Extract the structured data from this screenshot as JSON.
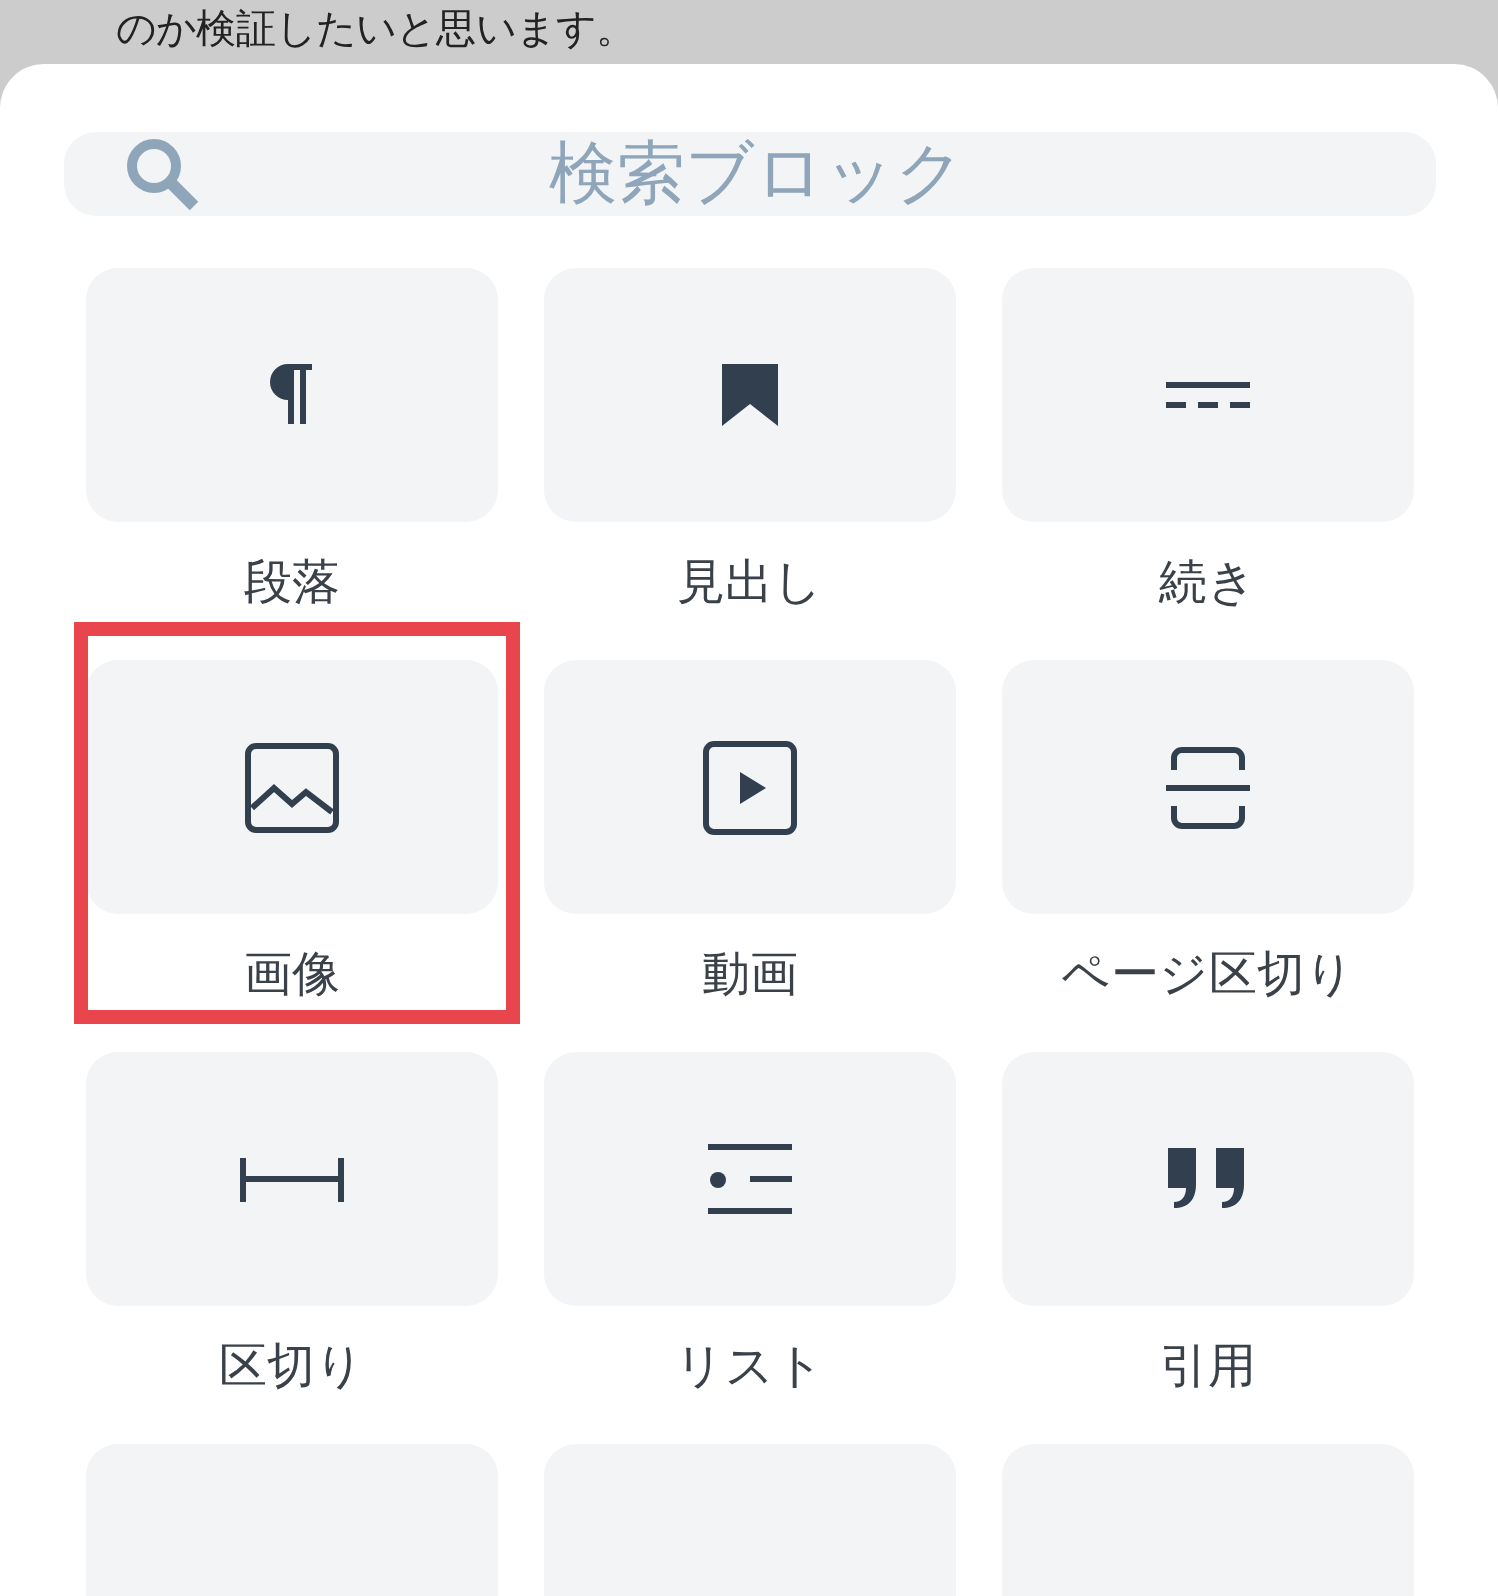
{
  "background_text": "のか検証したいと思います。",
  "search": {
    "placeholder": "検索ブロック"
  },
  "blocks": [
    {
      "kind": "paragraph",
      "label": "段落",
      "highlighted": false
    },
    {
      "kind": "heading",
      "label": "見出し",
      "highlighted": false
    },
    {
      "kind": "more",
      "label": "続き",
      "highlighted": false
    },
    {
      "kind": "image",
      "label": "画像",
      "highlighted": true
    },
    {
      "kind": "video",
      "label": "動画",
      "highlighted": false
    },
    {
      "kind": "pagebreak",
      "label": "ページ区切り",
      "highlighted": false
    },
    {
      "kind": "separator",
      "label": "区切り",
      "highlighted": false
    },
    {
      "kind": "list",
      "label": "リスト",
      "highlighted": false
    },
    {
      "kind": "quote",
      "label": "引用",
      "highlighted": false
    },
    {
      "kind": "blank"
    },
    {
      "kind": "blank"
    },
    {
      "kind": "blank"
    }
  ]
}
